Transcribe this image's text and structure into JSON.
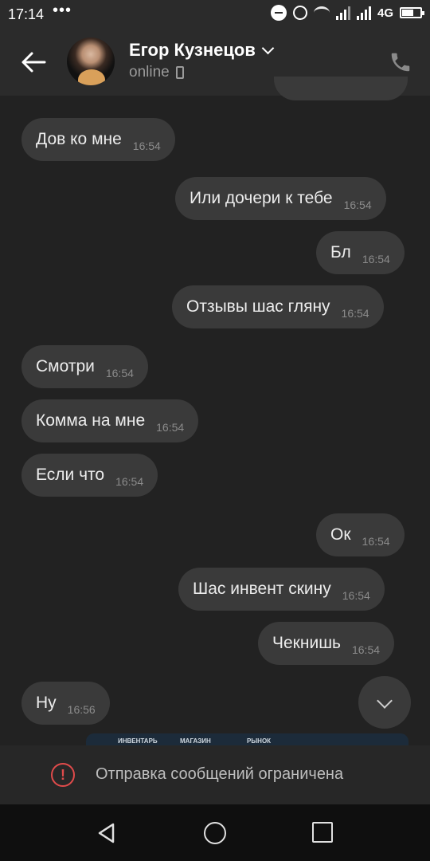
{
  "status_bar": {
    "time": "17:14",
    "dots": "•••",
    "network": "4G"
  },
  "header": {
    "contact_name": "Егор Кузнецов",
    "status": "online"
  },
  "messages": [
    {
      "text": "Дов ко мне",
      "time": "16:54",
      "side": "in"
    },
    {
      "text": "Или дочери к тебе",
      "time": "16:54",
      "side": "out"
    },
    {
      "text": "Бл",
      "time": "16:54",
      "side": "out"
    },
    {
      "text": "Отзывы шас гляну",
      "time": "16:54",
      "side": "out"
    },
    {
      "text": "Смотри",
      "time": "16:54",
      "side": "in"
    },
    {
      "text": "Комма на мне",
      "time": "16:54",
      "side": "in"
    },
    {
      "text": "Если что",
      "time": "16:54",
      "side": "in"
    },
    {
      "text": "Ок",
      "time": "16:54",
      "side": "out"
    },
    {
      "text": "Шас инвент скину",
      "time": "16:54",
      "side": "out"
    },
    {
      "text": "Чекнишь",
      "time": "16:54",
      "side": "out"
    },
    {
      "text": "Ну",
      "time": "16:56",
      "side": "in"
    }
  ],
  "image_preview": {
    "tabs": [
      "ИНВЕНТАРЬ",
      "МАГАЗИН",
      "РЫНОК"
    ]
  },
  "restriction": {
    "text": "Отправка сообщений ограничена"
  },
  "icons": [
    "back-arrow-icon",
    "phone-call-icon",
    "device-icon",
    "chevron-down-icon",
    "warning-icon",
    "nav-back-icon",
    "nav-home-icon",
    "nav-recent-icon"
  ]
}
